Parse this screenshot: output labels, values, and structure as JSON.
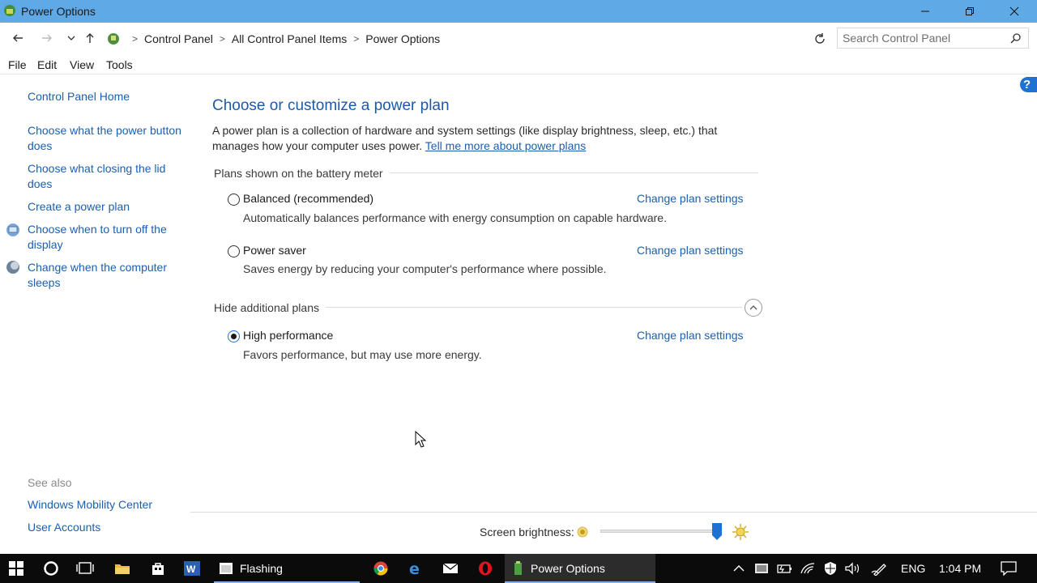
{
  "window": {
    "title": "Power Options"
  },
  "nav": {
    "breadcrumbs": [
      "Control Panel",
      "All Control Panel Items",
      "Power Options"
    ],
    "search_placeholder": "Search Control Panel"
  },
  "menu": [
    "File",
    "Edit",
    "View",
    "Tools"
  ],
  "sidebar": {
    "home": "Control Panel Home",
    "links": [
      "Choose what the power button does",
      "Choose what closing the lid does",
      "Create a power plan",
      "Choose when to turn off the display",
      "Change when the computer sleeps"
    ],
    "see_also_label": "See also",
    "see_also": [
      "Windows Mobility Center",
      "User Accounts"
    ]
  },
  "main": {
    "heading": "Choose or customize a power plan",
    "description": "A power plan is a collection of hardware and system settings (like display brightness, sleep, etc.) that manages how your computer uses power.",
    "learn_more": "Tell me more about power plans",
    "battery_meter_label": "Plans shown on the battery meter",
    "hide_additional_label": "Hide additional plans",
    "change_link": "Change plan settings",
    "plans": [
      {
        "name": "Balanced (recommended)",
        "desc": "Automatically balances performance with energy consumption on capable hardware.",
        "selected": false
      },
      {
        "name": "Power saver",
        "desc": "Saves energy by reducing your computer's performance where possible.",
        "selected": false
      },
      {
        "name": "High performance",
        "desc": "Favors performance, but may use more energy.",
        "selected": true
      }
    ],
    "brightness_label": "Screen brightness:",
    "brightness_level": 1.0
  },
  "taskbar": {
    "apps": [
      "Flashing",
      "Power Options"
    ],
    "language": "ENG",
    "time": "1:04 PM"
  },
  "colors": {
    "titlebar": "#5ea9e6",
    "link": "#1b5fb0",
    "heading": "#1c5aa8",
    "taskbar": "#0b0b0b",
    "accent": "#1e73d2"
  }
}
